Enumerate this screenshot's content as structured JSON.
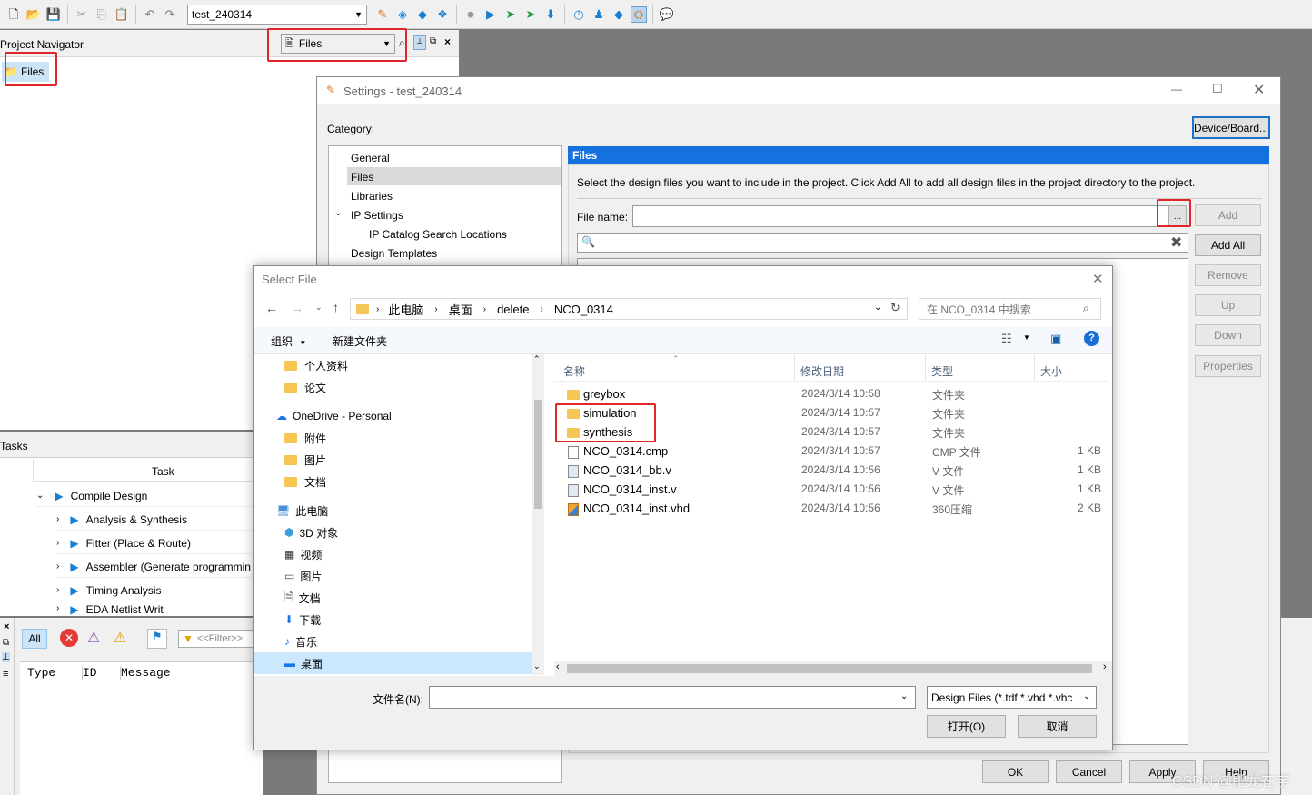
{
  "toolbar": {
    "project_combo": "test_240314"
  },
  "navigator": {
    "title": "Project Navigator",
    "view_combo": "Files",
    "tree_item": "Files"
  },
  "tasks": {
    "title": "Tasks",
    "column": "Task",
    "items": [
      {
        "label": "Compile Design"
      },
      {
        "label": "Analysis & Synthesis"
      },
      {
        "label": "Fitter (Place & Route)"
      },
      {
        "label": "Assembler (Generate programmin"
      },
      {
        "label": "Timing Analysis"
      },
      {
        "label": "EDA Netlist Writ"
      }
    ]
  },
  "messages": {
    "filter_all": "All",
    "filter_placeholder": "<<Filter>>",
    "columns": [
      "Type",
      "ID",
      "Message"
    ]
  },
  "settings": {
    "title": "Settings - test_240314",
    "category_label": "Category:",
    "device_board_button": "Device/Board...",
    "categories": [
      "General",
      "Files",
      "Libraries",
      "IP Settings",
      "IP Catalog Search Locations",
      "Design Templates"
    ],
    "files_header": "Files",
    "description": "Select the design files you want to include in the project. Click Add All to add all design files in the project directory to the project.",
    "file_name_label": "File name:",
    "browse_label": "...",
    "buttons": {
      "add": "Add",
      "add_all": "Add All",
      "remove": "Remove",
      "up": "Up",
      "down": "Down",
      "properties": "Properties"
    },
    "footer": {
      "ok": "OK",
      "cancel": "Cancel",
      "apply": "Apply",
      "help": "Help"
    }
  },
  "select_file": {
    "title": "Select File",
    "breadcrumb": [
      "此电脑",
      "桌面",
      "delete",
      "NCO_0314"
    ],
    "search_placeholder": "在 NCO_0314 中搜索",
    "organize": "组织",
    "new_folder": "新建文件夹",
    "nav_items": [
      {
        "label": "个人资料",
        "icon": "folder-icon"
      },
      {
        "label": "论文",
        "icon": "folder-icon"
      },
      {
        "label": "OneDrive - Personal",
        "icon": "cloud-icon"
      },
      {
        "label": "附件",
        "icon": "folder-icon"
      },
      {
        "label": "图片",
        "icon": "folder-icon"
      },
      {
        "label": "文档",
        "icon": "folder-icon"
      },
      {
        "label": "此电脑",
        "icon": "computer-icon"
      },
      {
        "label": "3D 对象",
        "icon": "cube-icon"
      },
      {
        "label": "视频",
        "icon": "film-icon"
      },
      {
        "label": "图片",
        "icon": "picture-icon"
      },
      {
        "label": "文档",
        "icon": "document-icon"
      },
      {
        "label": "下载",
        "icon": "download-icon"
      },
      {
        "label": "音乐",
        "icon": "music-icon"
      },
      {
        "label": "桌面",
        "icon": "desktop-icon"
      }
    ],
    "columns": {
      "name": "名称",
      "date": "修改日期",
      "type": "类型",
      "size": "大小"
    },
    "files": [
      {
        "name": "greybox",
        "date": "2024/3/14 10:58",
        "type": "文件夹",
        "size": "",
        "kind": "folder"
      },
      {
        "name": "simulation",
        "date": "2024/3/14 10:57",
        "type": "文件夹",
        "size": "",
        "kind": "folder"
      },
      {
        "name": "synthesis",
        "date": "2024/3/14 10:57",
        "type": "文件夹",
        "size": "",
        "kind": "folder"
      },
      {
        "name": "NCO_0314.cmp",
        "date": "2024/3/14 10:57",
        "type": "CMP 文件",
        "size": "1 KB",
        "kind": "file"
      },
      {
        "name": "NCO_0314_bb.v",
        "date": "2024/3/14 10:56",
        "type": "V 文件",
        "size": "1 KB",
        "kind": "vfile"
      },
      {
        "name": "NCO_0314_inst.v",
        "date": "2024/3/14 10:56",
        "type": "V 文件",
        "size": "1 KB",
        "kind": "vfile"
      },
      {
        "name": "NCO_0314_inst.vhd",
        "date": "2024/3/14 10:56",
        "type": "360压缩",
        "size": "2 KB",
        "kind": "archive"
      }
    ],
    "filename_label": "文件名(N):",
    "filename_value": "",
    "filter_combo": "Design Files (*.tdf *.vhd *.vhc",
    "open_button": "打开(O)",
    "cancel_button": "取消"
  },
  "watermark": "CSDN @肥龙在学"
}
